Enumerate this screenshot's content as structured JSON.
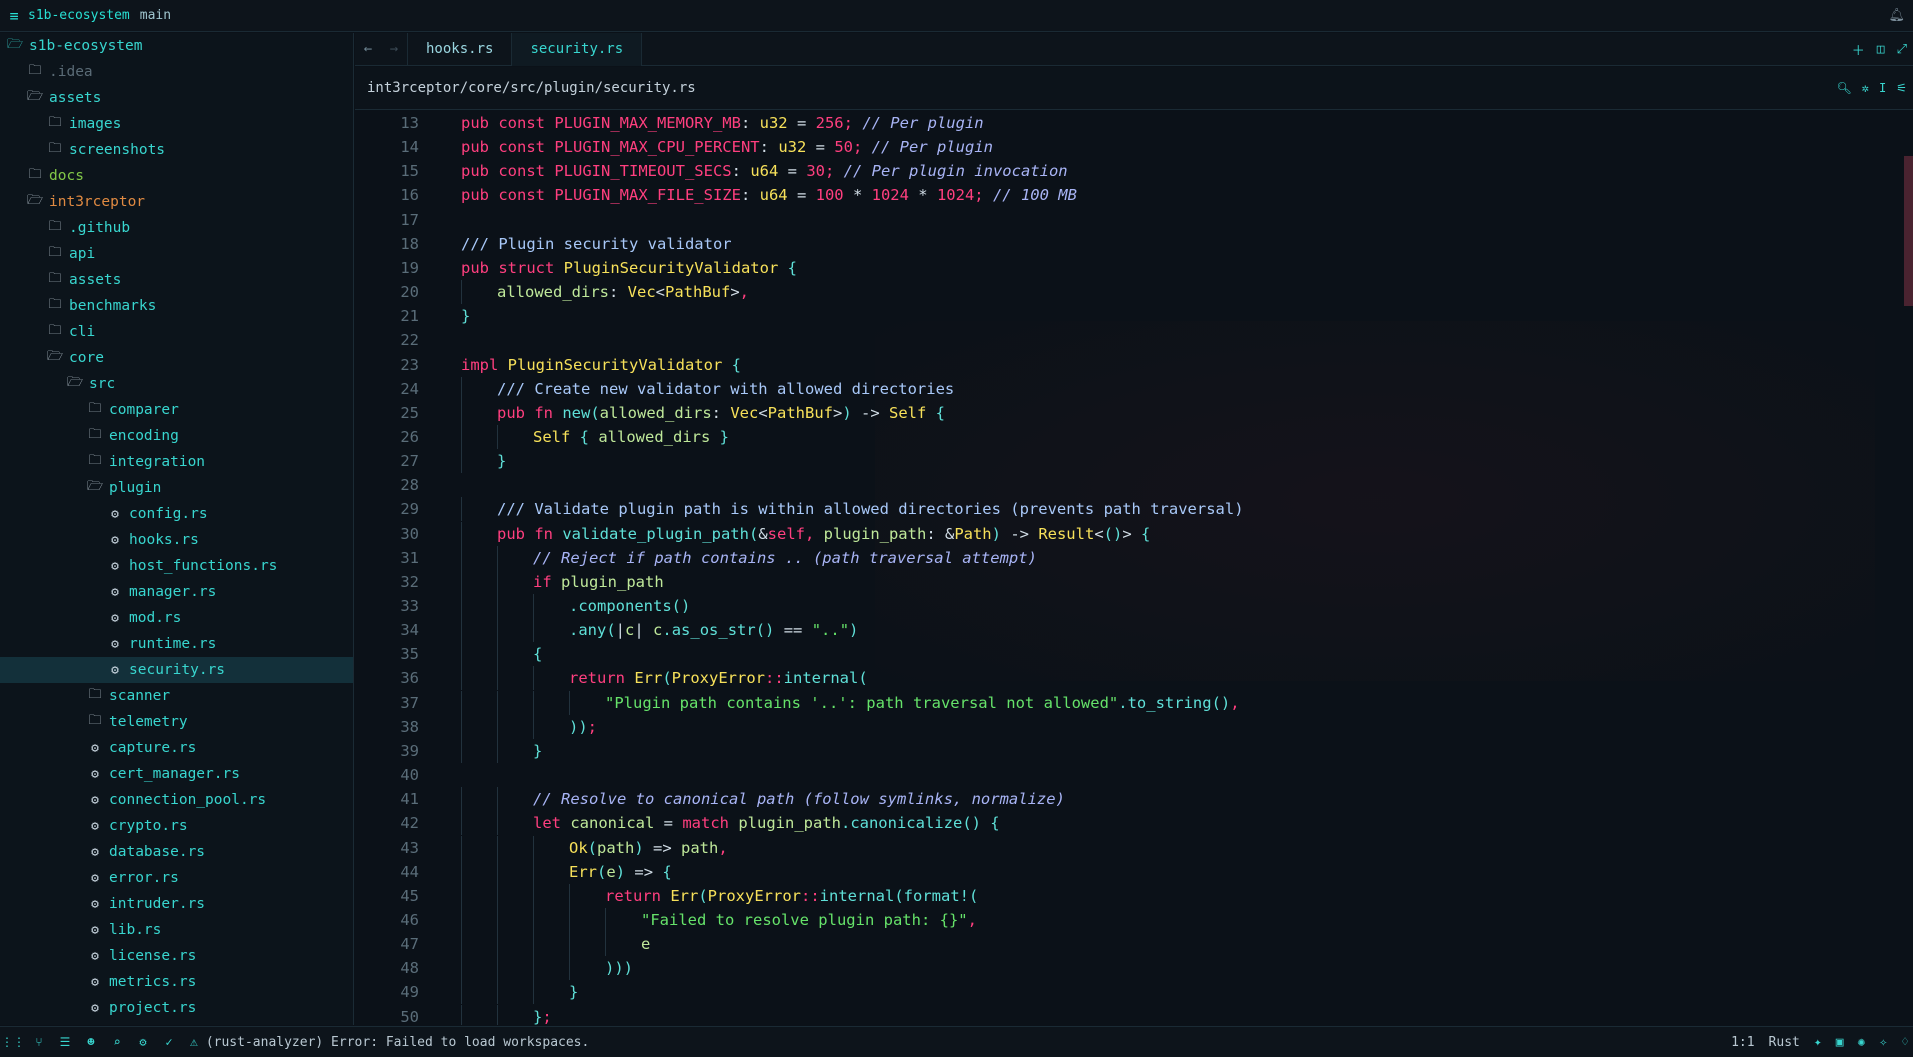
{
  "titlebar": {
    "menu_icon": "hamburger-icon",
    "project": "s1b-ecosystem",
    "branch": "main",
    "right_icon": "bell-icon"
  },
  "sidebar": {
    "items": [
      {
        "label": "s1b-ecosystem",
        "type": "folder-open",
        "depth": 0,
        "style": "root"
      },
      {
        "label": ".idea",
        "type": "folder",
        "depth": 1,
        "style": "dim"
      },
      {
        "label": "assets",
        "type": "folder-open",
        "depth": 1,
        "style": ""
      },
      {
        "label": "images",
        "type": "folder",
        "depth": 2,
        "style": ""
      },
      {
        "label": "screenshots",
        "type": "folder",
        "depth": 2,
        "style": ""
      },
      {
        "label": "docs",
        "type": "folder",
        "depth": 1,
        "style": "green"
      },
      {
        "label": "int3rceptor",
        "type": "folder-open",
        "depth": 1,
        "style": "orange"
      },
      {
        "label": ".github",
        "type": "folder",
        "depth": 2,
        "style": ""
      },
      {
        "label": "api",
        "type": "folder",
        "depth": 2,
        "style": ""
      },
      {
        "label": "assets",
        "type": "folder",
        "depth": 2,
        "style": ""
      },
      {
        "label": "benchmarks",
        "type": "folder",
        "depth": 2,
        "style": ""
      },
      {
        "label": "cli",
        "type": "folder",
        "depth": 2,
        "style": ""
      },
      {
        "label": "core",
        "type": "folder-open",
        "depth": 2,
        "style": ""
      },
      {
        "label": "src",
        "type": "folder-open",
        "depth": 3,
        "style": ""
      },
      {
        "label": "comparer",
        "type": "folder",
        "depth": 4,
        "style": ""
      },
      {
        "label": "encoding",
        "type": "folder",
        "depth": 4,
        "style": ""
      },
      {
        "label": "integration",
        "type": "folder",
        "depth": 4,
        "style": ""
      },
      {
        "label": "plugin",
        "type": "folder-open",
        "depth": 4,
        "style": ""
      },
      {
        "label": "config.rs",
        "type": "rust",
        "depth": 5,
        "style": ""
      },
      {
        "label": "hooks.rs",
        "type": "rust",
        "depth": 5,
        "style": ""
      },
      {
        "label": "host_functions.rs",
        "type": "rust",
        "depth": 5,
        "style": ""
      },
      {
        "label": "manager.rs",
        "type": "rust",
        "depth": 5,
        "style": ""
      },
      {
        "label": "mod.rs",
        "type": "rust",
        "depth": 5,
        "style": ""
      },
      {
        "label": "runtime.rs",
        "type": "rust",
        "depth": 5,
        "style": ""
      },
      {
        "label": "security.rs",
        "type": "rust",
        "depth": 5,
        "style": "selected"
      },
      {
        "label": "scanner",
        "type": "folder",
        "depth": 4,
        "style": ""
      },
      {
        "label": "telemetry",
        "type": "folder",
        "depth": 4,
        "style": ""
      },
      {
        "label": "capture.rs",
        "type": "rust",
        "depth": 4,
        "style": ""
      },
      {
        "label": "cert_manager.rs",
        "type": "rust",
        "depth": 4,
        "style": ""
      },
      {
        "label": "connection_pool.rs",
        "type": "rust",
        "depth": 4,
        "style": ""
      },
      {
        "label": "crypto.rs",
        "type": "rust",
        "depth": 4,
        "style": ""
      },
      {
        "label": "database.rs",
        "type": "rust",
        "depth": 4,
        "style": ""
      },
      {
        "label": "error.rs",
        "type": "rust",
        "depth": 4,
        "style": ""
      },
      {
        "label": "intruder.rs",
        "type": "rust",
        "depth": 4,
        "style": ""
      },
      {
        "label": "lib.rs",
        "type": "rust",
        "depth": 4,
        "style": ""
      },
      {
        "label": "license.rs",
        "type": "rust",
        "depth": 4,
        "style": ""
      },
      {
        "label": "metrics.rs",
        "type": "rust",
        "depth": 4,
        "style": ""
      },
      {
        "label": "project.rs",
        "type": "rust",
        "depth": 4,
        "style": ""
      }
    ]
  },
  "tabs": [
    {
      "label": "hooks.rs",
      "active": false
    },
    {
      "label": "security.rs",
      "active": true
    }
  ],
  "breadcrumb": {
    "path": "int3rceptor/core/src/plugin/security.rs"
  },
  "editor": {
    "lines": [
      {
        "n": 13,
        "indent": 0,
        "tokens": [
          [
            "kw",
            "pub "
          ],
          [
            "kw",
            "const "
          ],
          [
            "cn",
            "PLUGIN_MAX_MEMORY_MB"
          ],
          [
            "pn",
            ": "
          ],
          [
            "ty",
            "u32"
          ],
          [
            "pn",
            " = "
          ],
          [
            "num",
            "256"
          ],
          [
            "kw",
            ";"
          ],
          [
            "cm",
            " // Per plugin"
          ]
        ]
      },
      {
        "n": 14,
        "indent": 0,
        "tokens": [
          [
            "kw",
            "pub "
          ],
          [
            "kw",
            "const "
          ],
          [
            "cn",
            "PLUGIN_MAX_CPU_PERCENT"
          ],
          [
            "pn",
            ": "
          ],
          [
            "ty",
            "u32"
          ],
          [
            "pn",
            " = "
          ],
          [
            "num",
            "50"
          ],
          [
            "kw",
            ";"
          ],
          [
            "cm",
            " // Per plugin"
          ]
        ]
      },
      {
        "n": 15,
        "indent": 0,
        "tokens": [
          [
            "kw",
            "pub "
          ],
          [
            "kw",
            "const "
          ],
          [
            "cn",
            "PLUGIN_TIMEOUT_SECS"
          ],
          [
            "pn",
            ": "
          ],
          [
            "ty",
            "u64"
          ],
          [
            "pn",
            " = "
          ],
          [
            "num",
            "30"
          ],
          [
            "kw",
            ";"
          ],
          [
            "cm",
            " // Per plugin invocation"
          ]
        ]
      },
      {
        "n": 16,
        "indent": 0,
        "tokens": [
          [
            "kw",
            "pub "
          ],
          [
            "kw",
            "const "
          ],
          [
            "cn",
            "PLUGIN_MAX_FILE_SIZE"
          ],
          [
            "pn",
            ": "
          ],
          [
            "ty",
            "u64"
          ],
          [
            "pn",
            " = "
          ],
          [
            "num",
            "100"
          ],
          [
            "pn",
            " * "
          ],
          [
            "num",
            "1024"
          ],
          [
            "pn",
            " * "
          ],
          [
            "num",
            "1024"
          ],
          [
            "kw",
            ";"
          ],
          [
            "cm",
            " // 100 MB"
          ]
        ]
      },
      {
        "n": 17,
        "indent": 0,
        "tokens": []
      },
      {
        "n": 18,
        "indent": 0,
        "tokens": [
          [
            "doc",
            "/// Plugin security validator"
          ]
        ]
      },
      {
        "n": 19,
        "indent": 0,
        "tokens": [
          [
            "kw",
            "pub "
          ],
          [
            "kw",
            "struct "
          ],
          [
            "ty",
            "PluginSecurityValidator"
          ],
          [
            "fn",
            " {"
          ]
        ]
      },
      {
        "n": 20,
        "indent": 1,
        "tokens": [
          [
            "va",
            "allowed_dirs"
          ],
          [
            "pn",
            ": "
          ],
          [
            "ty",
            "Vec"
          ],
          [
            "pn",
            "<"
          ],
          [
            "ty",
            "PathBuf"
          ],
          [
            "pn",
            ">"
          ],
          [
            "kw",
            ","
          ]
        ]
      },
      {
        "n": 21,
        "indent": 0,
        "tokens": [
          [
            "fn",
            "}"
          ]
        ]
      },
      {
        "n": 22,
        "indent": 0,
        "tokens": []
      },
      {
        "n": 23,
        "indent": 0,
        "tokens": [
          [
            "kw",
            "impl "
          ],
          [
            "ty",
            "PluginSecurityValidator"
          ],
          [
            "fn",
            " {"
          ]
        ]
      },
      {
        "n": 24,
        "indent": 1,
        "tokens": [
          [
            "doc",
            "/// Create new validator with allowed directories"
          ]
        ]
      },
      {
        "n": 25,
        "indent": 1,
        "tokens": [
          [
            "kw",
            "pub "
          ],
          [
            "kw",
            "fn "
          ],
          [
            "fn",
            "new"
          ],
          [
            "fn",
            "("
          ],
          [
            "va",
            "allowed_dirs"
          ],
          [
            "pn",
            ": "
          ],
          [
            "ty",
            "Vec"
          ],
          [
            "pn",
            "<"
          ],
          [
            "ty",
            "PathBuf"
          ],
          [
            "pn",
            ">"
          ],
          [
            "fn",
            ")"
          ],
          [
            "pn",
            " -> "
          ],
          [
            "ty",
            "Self"
          ],
          [
            "fn",
            " {"
          ]
        ]
      },
      {
        "n": 26,
        "indent": 2,
        "tokens": [
          [
            "ty",
            "Self"
          ],
          [
            "fn",
            " { "
          ],
          [
            "va",
            "allowed_dirs"
          ],
          [
            "fn",
            " }"
          ]
        ]
      },
      {
        "n": 27,
        "indent": 1,
        "tokens": [
          [
            "fn",
            "}"
          ]
        ]
      },
      {
        "n": 28,
        "indent": 0,
        "tokens": []
      },
      {
        "n": 29,
        "indent": 1,
        "tokens": [
          [
            "doc",
            "/// Validate plugin path is within allowed directories (prevents path traversal)"
          ]
        ]
      },
      {
        "n": 30,
        "indent": 1,
        "tokens": [
          [
            "kw",
            "pub "
          ],
          [
            "kw",
            "fn "
          ],
          [
            "fn",
            "validate_plugin_path"
          ],
          [
            "fn",
            "("
          ],
          [
            "pn",
            "&"
          ],
          [
            "kw",
            "self"
          ],
          [
            "kw",
            ", "
          ],
          [
            "va",
            "plugin_path"
          ],
          [
            "pn",
            ": &"
          ],
          [
            "ty",
            "Path"
          ],
          [
            "fn",
            ")"
          ],
          [
            "pn",
            " -> "
          ],
          [
            "ty",
            "Result"
          ],
          [
            "pn",
            "<"
          ],
          [
            "fn",
            "()"
          ],
          [
            "pn",
            "> "
          ],
          [
            "fn",
            "{"
          ]
        ]
      },
      {
        "n": 31,
        "indent": 2,
        "tokens": [
          [
            "cm",
            "// Reject if path contains .. (path traversal attempt)"
          ]
        ]
      },
      {
        "n": 32,
        "indent": 2,
        "tokens": [
          [
            "kw",
            "if "
          ],
          [
            "va",
            "plugin_path"
          ]
        ]
      },
      {
        "n": 33,
        "indent": 3,
        "tokens": [
          [
            "fn",
            ".components"
          ],
          [
            "fn",
            "()"
          ]
        ]
      },
      {
        "n": 34,
        "indent": 3,
        "tokens": [
          [
            "fn",
            ".any"
          ],
          [
            "fn",
            "("
          ],
          [
            "pn",
            "|"
          ],
          [
            "va",
            "c"
          ],
          [
            "pn",
            "| "
          ],
          [
            "va",
            "c"
          ],
          [
            "fn",
            ".as_os_str"
          ],
          [
            "fn",
            "()"
          ],
          [
            "pn",
            " == "
          ],
          [
            "str",
            "\"..\""
          ],
          [
            "fn",
            ")"
          ]
        ]
      },
      {
        "n": 35,
        "indent": 2,
        "tokens": [
          [
            "fn",
            "{"
          ]
        ]
      },
      {
        "n": 36,
        "indent": 3,
        "tokens": [
          [
            "kw",
            "return "
          ],
          [
            "ty",
            "Err"
          ],
          [
            "fn",
            "("
          ],
          [
            "ty",
            "ProxyError"
          ],
          [
            "kw",
            "::"
          ],
          [
            "fn",
            "internal"
          ],
          [
            "fn",
            "("
          ]
        ]
      },
      {
        "n": 37,
        "indent": 4,
        "tokens": [
          [
            "str",
            "\"Plugin path contains '..': path traversal not allowed\""
          ],
          [
            "fn",
            ".to_string"
          ],
          [
            "fn",
            "()"
          ],
          [
            "kw",
            ","
          ]
        ]
      },
      {
        "n": 38,
        "indent": 3,
        "tokens": [
          [
            "fn",
            "))"
          ],
          [
            "kw",
            ";"
          ]
        ]
      },
      {
        "n": 39,
        "indent": 2,
        "tokens": [
          [
            "fn",
            "}"
          ]
        ]
      },
      {
        "n": 40,
        "indent": 0,
        "tokens": []
      },
      {
        "n": 41,
        "indent": 2,
        "tokens": [
          [
            "cm",
            "// Resolve to canonical path (follow symlinks, normalize)"
          ]
        ]
      },
      {
        "n": 42,
        "indent": 2,
        "tokens": [
          [
            "kw",
            "let "
          ],
          [
            "va",
            "canonical"
          ],
          [
            "pn",
            " = "
          ],
          [
            "kw",
            "match "
          ],
          [
            "va",
            "plugin_path"
          ],
          [
            "fn",
            ".canonicalize"
          ],
          [
            "fn",
            "() {"
          ]
        ]
      },
      {
        "n": 43,
        "indent": 3,
        "tokens": [
          [
            "ty",
            "Ok"
          ],
          [
            "fn",
            "("
          ],
          [
            "va",
            "path"
          ],
          [
            "fn",
            ")"
          ],
          [
            "pn",
            " => "
          ],
          [
            "va",
            "path"
          ],
          [
            "kw",
            ","
          ]
        ]
      },
      {
        "n": 44,
        "indent": 3,
        "tokens": [
          [
            "ty",
            "Err"
          ],
          [
            "fn",
            "("
          ],
          [
            "va",
            "e"
          ],
          [
            "fn",
            ")"
          ],
          [
            "pn",
            " => "
          ],
          [
            "fn",
            "{"
          ]
        ]
      },
      {
        "n": 45,
        "indent": 4,
        "tokens": [
          [
            "kw",
            "return "
          ],
          [
            "ty",
            "Err"
          ],
          [
            "fn",
            "("
          ],
          [
            "ty",
            "ProxyError"
          ],
          [
            "kw",
            "::"
          ],
          [
            "fn",
            "internal"
          ],
          [
            "fn",
            "("
          ],
          [
            "mac",
            "format!"
          ],
          [
            "fn",
            "("
          ]
        ]
      },
      {
        "n": 46,
        "indent": 5,
        "tokens": [
          [
            "str",
            "\"Failed to resolve plugin path: {}\""
          ],
          [
            "kw",
            ","
          ]
        ]
      },
      {
        "n": 47,
        "indent": 5,
        "tokens": [
          [
            "va",
            "e"
          ]
        ]
      },
      {
        "n": 48,
        "indent": 4,
        "tokens": [
          [
            "fn",
            ")))"
          ]
        ]
      },
      {
        "n": 49,
        "indent": 3,
        "tokens": [
          [
            "fn",
            "}"
          ]
        ]
      },
      {
        "n": 50,
        "indent": 2,
        "tokens": [
          [
            "fn",
            "}"
          ],
          [
            "kw",
            ";"
          ]
        ]
      }
    ]
  },
  "statusbar": {
    "message": "(rust-analyzer) Error: Failed to load workspaces.",
    "position": "1:1",
    "language": "Rust"
  }
}
